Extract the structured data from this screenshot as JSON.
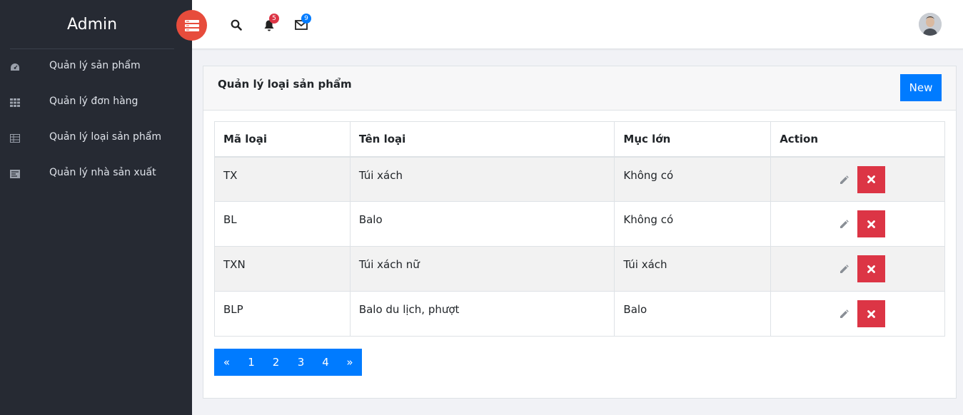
{
  "sidebar": {
    "brand": "Admin",
    "items": [
      {
        "label": "Quản lý sản phẩm",
        "icon": "dashboard-icon"
      },
      {
        "label": "Quản lý đơn hàng",
        "icon": "grid-icon"
      },
      {
        "label": "Quản lý loại sản phẩm",
        "icon": "table-icon"
      },
      {
        "label": "Quản lý nhà sản xuất",
        "icon": "list-icon"
      }
    ]
  },
  "topbar": {
    "toggle_icon": "menu-toggle-icon",
    "search_icon": "search-icon",
    "notifications": {
      "icon": "bell-icon",
      "count": "5"
    },
    "messages": {
      "icon": "envelope-icon",
      "count": "9"
    },
    "avatar_icon": "user-avatar"
  },
  "card": {
    "title": "Quản lý loại sản phẩm",
    "new_label": "New"
  },
  "table": {
    "headers": [
      "Mã loại",
      "Tên loại",
      "Mục lớn",
      "Action"
    ],
    "rows": [
      {
        "code": "TX",
        "name": "Túi xách",
        "parent": "Không có"
      },
      {
        "code": "BL",
        "name": "Balo",
        "parent": "Không có"
      },
      {
        "code": "TXN",
        "name": "Túi xách nữ",
        "parent": "Túi xách"
      },
      {
        "code": "BLP",
        "name": "Balo du lịch, phượt",
        "parent": "Balo"
      }
    ]
  },
  "pagination": {
    "prev": "«",
    "pages": [
      "1",
      "2",
      "3",
      "4"
    ],
    "next": "»"
  },
  "colors": {
    "sidebar_bg": "#262a33",
    "accent_blue": "#007bff",
    "danger_red": "#dc3545",
    "toggle_red": "#e74c3c"
  }
}
